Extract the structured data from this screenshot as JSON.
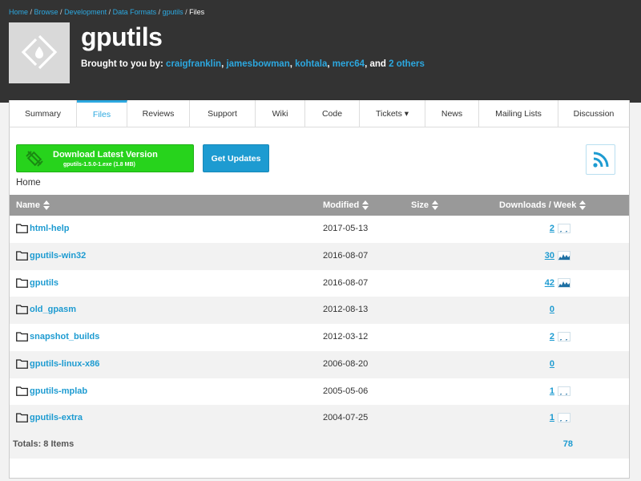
{
  "breadcrumb": [
    {
      "label": "Home",
      "link": true
    },
    {
      "label": "Browse",
      "link": true
    },
    {
      "label": "Development",
      "link": true
    },
    {
      "label": "Data Formats",
      "link": true
    },
    {
      "label": "gputils",
      "link": true
    },
    {
      "label": "Files",
      "link": false
    }
  ],
  "project": {
    "title": "gputils",
    "byline_prefix": "Brought to you by:",
    "authors": [
      "craigfranklin",
      "jamesbowman",
      "kohtala",
      "merc64"
    ],
    "and_text": ", and",
    "others_link": "2 others"
  },
  "tabs": [
    {
      "label": "Summary",
      "active": false
    },
    {
      "label": "Files",
      "active": true
    },
    {
      "label": "Reviews",
      "active": false
    },
    {
      "label": "Support",
      "active": false
    },
    {
      "label": "Wiki",
      "active": false
    },
    {
      "label": "Code",
      "active": false
    },
    {
      "label": "Tickets ▾",
      "active": false
    },
    {
      "label": "News",
      "active": false
    },
    {
      "label": "Mailing Lists",
      "active": false
    },
    {
      "label": "Discussion",
      "active": false
    }
  ],
  "toolbar": {
    "download_title": "Download Latest Version",
    "download_file": "gputils-1.5.0-1.exe (1.8 MB)",
    "updates_label": "Get Updates"
  },
  "location": "Home",
  "table": {
    "columns": {
      "name": "Name",
      "modified": "Modified",
      "size": "Size",
      "downloads": "Downloads / Week"
    },
    "rows": [
      {
        "name": "html-help",
        "modified": "2017-05-13",
        "downloads": "2",
        "spark": "low"
      },
      {
        "name": "gputils-win32",
        "modified": "2016-08-07",
        "downloads": "30",
        "spark": "high"
      },
      {
        "name": "gputils",
        "modified": "2016-08-07",
        "downloads": "42",
        "spark": "high"
      },
      {
        "name": "old_gpasm",
        "modified": "2012-08-13",
        "downloads": "0",
        "spark": "none"
      },
      {
        "name": "snapshot_builds",
        "modified": "2012-03-12",
        "downloads": "2",
        "spark": "low"
      },
      {
        "name": "gputils-linux-x86",
        "modified": "2006-08-20",
        "downloads": "0",
        "spark": "none"
      },
      {
        "name": "gputils-mplab",
        "modified": "2005-05-06",
        "downloads": "1",
        "spark": "low"
      },
      {
        "name": "gputils-extra",
        "modified": "2004-07-25",
        "downloads": "1",
        "spark": "low"
      }
    ],
    "totals_label": "Totals: 8 Items",
    "totals_value": "78"
  },
  "colors": {
    "header_bg": "#333333",
    "link": "#1d9bd1",
    "download_green": "#27d31c",
    "updates_blue": "#1d9bd1",
    "table_header": "#999999"
  }
}
